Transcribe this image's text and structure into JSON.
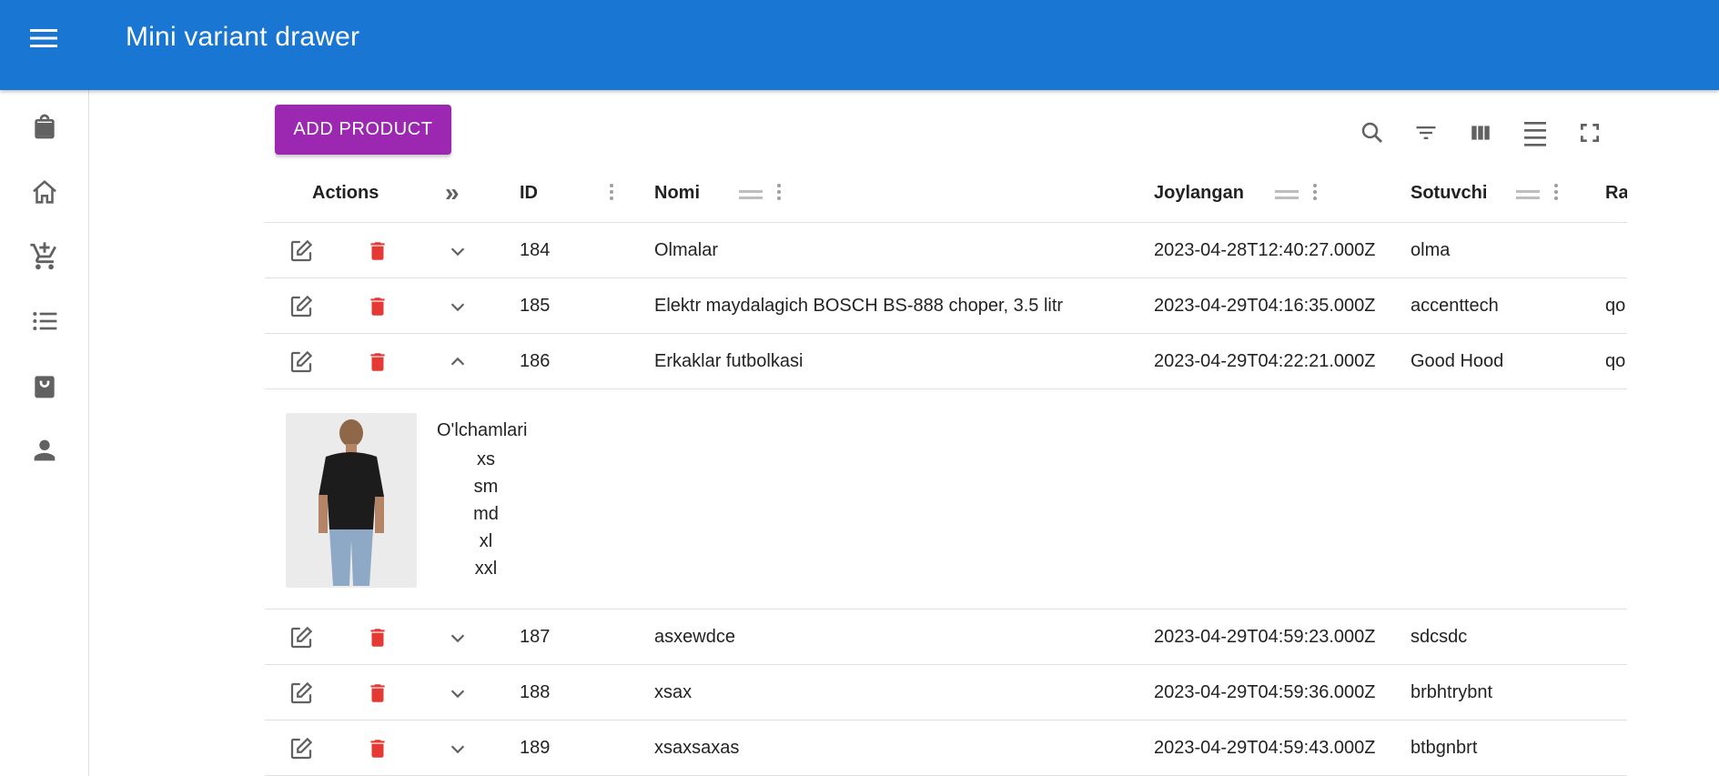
{
  "app": {
    "title": "Mini variant drawer"
  },
  "drawer": {
    "items": [
      {
        "icon": "shopping-bag-icon"
      },
      {
        "icon": "home-icon"
      },
      {
        "icon": "add-shopping-cart-icon"
      },
      {
        "icon": "list-icon"
      },
      {
        "icon": "shopping-basket-icon"
      },
      {
        "icon": "person-icon"
      }
    ]
  },
  "toolbar": {
    "add_label": "ADD PRODUCT",
    "icons": [
      "search-icon",
      "filter-icon",
      "columns-icon",
      "density-icon",
      "fullscreen-icon"
    ]
  },
  "table": {
    "headers": {
      "actions": "Actions",
      "expand": "»",
      "id": "ID",
      "name": "Nomi",
      "date": "Joylangan",
      "seller": "Sotuvchi",
      "next": "Ra"
    },
    "rows": [
      {
        "id": "184",
        "name": "Olmalar",
        "date": "2023-04-28T12:40:27.000Z",
        "seller": "olma",
        "next": ""
      },
      {
        "id": "185",
        "name": "Elektr maydalagich BOSCH BS-888 choper, 3.5 litr",
        "date": "2023-04-29T04:16:35.000Z",
        "seller": "accenttech",
        "next": "qo"
      },
      {
        "id": "186",
        "name": "Erkaklar futbolkasi",
        "date": "2023-04-29T04:22:21.000Z",
        "seller": "Good Hood",
        "next": "qo"
      },
      {
        "id": "187",
        "name": "asxewdce",
        "date": "2023-04-29T04:59:23.000Z",
        "seller": "sdcsdc",
        "next": ""
      },
      {
        "id": "188",
        "name": "xsax",
        "date": "2023-04-29T04:59:36.000Z",
        "seller": "brbhtrybnt",
        "next": ""
      },
      {
        "id": "189",
        "name": "xsaxsaxas",
        "date": "2023-04-29T04:59:43.000Z",
        "seller": "btbgnbrt",
        "next": ""
      }
    ],
    "detail": {
      "sizes_title": "O'lchamlari",
      "sizes": [
        "xs",
        "sm",
        "md",
        "xl",
        "xxl"
      ]
    }
  },
  "colors": {
    "appbar": "#1976d2",
    "add_button": "#9c27b0",
    "delete_icon": "#e53935",
    "edit_icon": "#616161"
  }
}
